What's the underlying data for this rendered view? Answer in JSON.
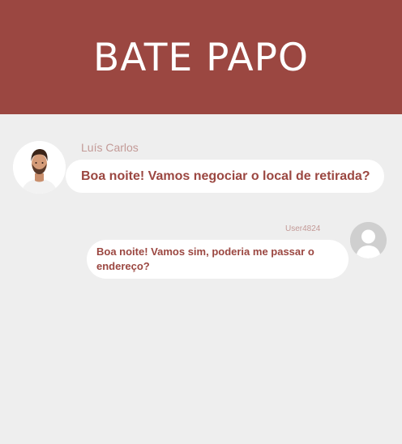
{
  "header": {
    "title": "BATE PAPO"
  },
  "messages": [
    {
      "sender": "Luís Carlos",
      "text": "Boa noite! Vamos negociar o local de retirada?",
      "avatar": "person-photo"
    },
    {
      "sender": "User4824",
      "text": "Boa noite! Vamos sim, poderia me passar o endereço?",
      "avatar": "user-generic-icon"
    }
  ],
  "colors": {
    "header_bg": "#9b4741",
    "page_bg": "#eeeeee",
    "bubble_bg": "#ffffff",
    "message_text": "#9b4741",
    "name_text": "#c39a97"
  }
}
